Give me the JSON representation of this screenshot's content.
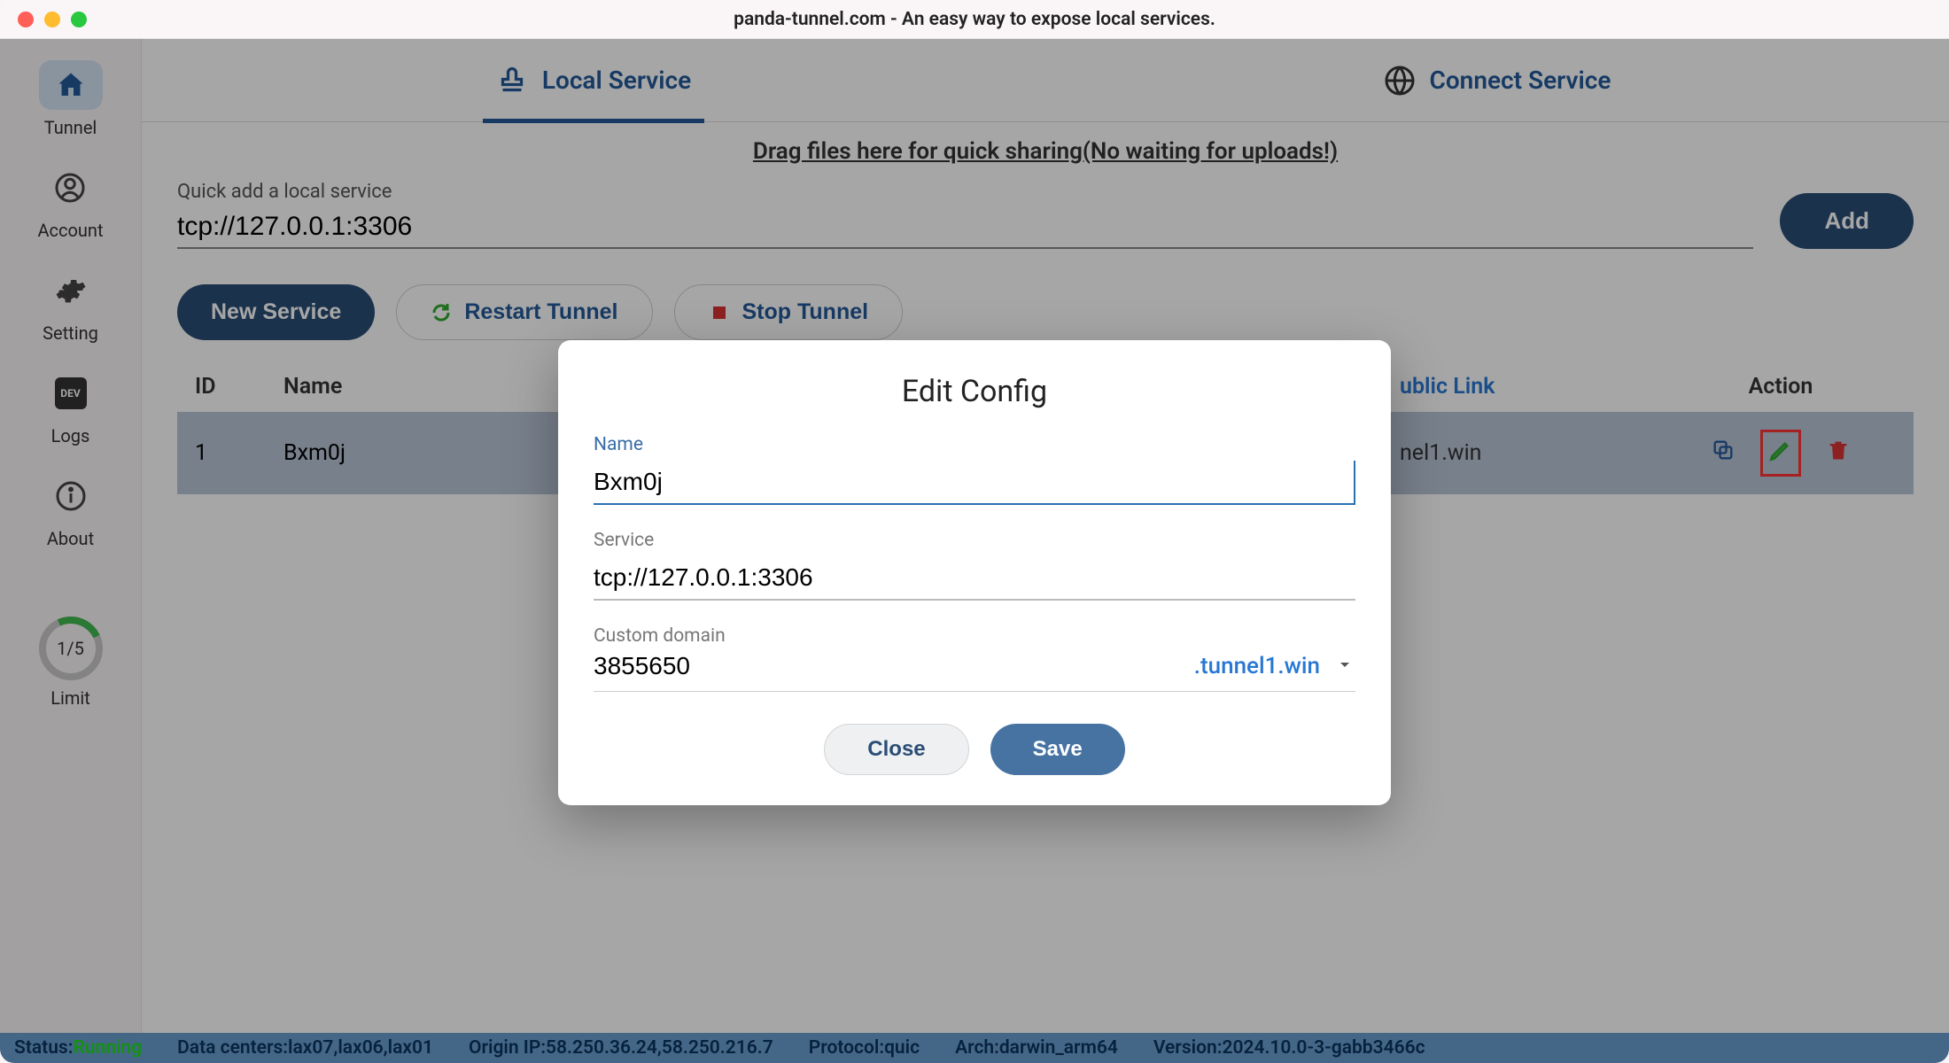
{
  "window": {
    "title": "panda-tunnel.com - An easy way to expose local services."
  },
  "sidebar": {
    "items": [
      {
        "label": "Tunnel",
        "icon": "home"
      },
      {
        "label": "Account",
        "icon": "user"
      },
      {
        "label": "Setting",
        "icon": "gear"
      },
      {
        "label": "Logs",
        "icon": "dev"
      },
      {
        "label": "About",
        "icon": "info"
      }
    ],
    "limit": {
      "label": "Limit",
      "value": "1/5"
    }
  },
  "tabs": {
    "local": {
      "label": "Local Service"
    },
    "connect": {
      "label": "Connect Service"
    }
  },
  "hint": "Drag files here for quick sharing(No waiting for uploads!)",
  "quickAdd": {
    "label": "Quick add a local service",
    "value": "tcp://127.0.0.1:3306",
    "button": "Add"
  },
  "buttons": {
    "new": "New Service",
    "restart": "Restart Tunnel",
    "stop": "Stop Tunnel"
  },
  "table": {
    "headers": {
      "id": "ID",
      "name": "Name",
      "link": "ublic Link",
      "action": "Action"
    },
    "rows": [
      {
        "id": "1",
        "name": "Bxm0j",
        "link_tail": "nel1.win"
      }
    ]
  },
  "modal": {
    "title": "Edit Config",
    "name": {
      "label": "Name",
      "value": "Bxm0j"
    },
    "service": {
      "label": "Service",
      "value": "tcp://127.0.0.1:3306"
    },
    "domain": {
      "label": "Custom domain",
      "value": "3855650",
      "suffix": ".tunnel1.win"
    },
    "close": "Close",
    "save": "Save"
  },
  "status": {
    "status_label": "Status:",
    "status_value": "Running",
    "dc_label": "Data centers:",
    "dc_value": "lax07,lax06,lax01",
    "ip_label": "Origin IP:",
    "ip_value": "58.250.36.24,58.250.216.7",
    "proto_label": "Protocol:",
    "proto_value": "quic",
    "arch_label": "Arch:",
    "arch_value": "darwin_arm64",
    "ver_label": "Version:",
    "ver_value": "2024.10.0-3-gabb3466c"
  }
}
